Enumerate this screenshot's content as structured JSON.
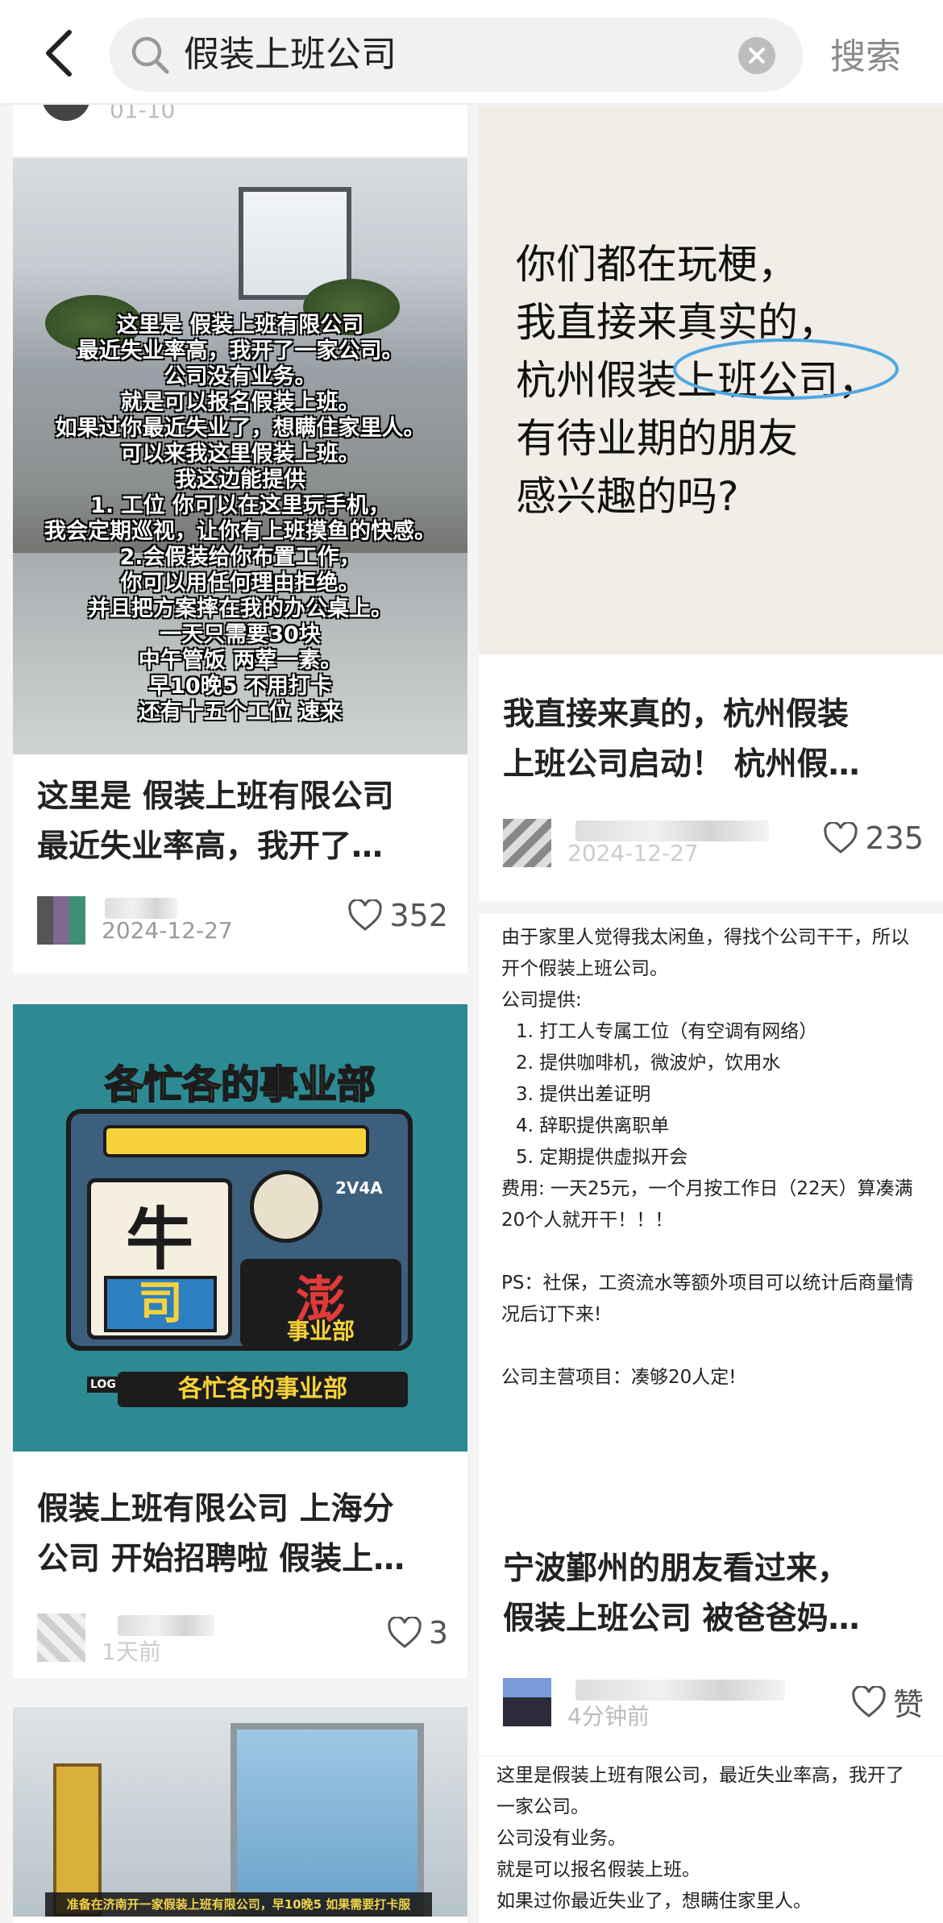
{
  "search": {
    "query": "假装上班公司",
    "button_label": "搜索"
  },
  "top_remnant": {
    "date": "01-10"
  },
  "left": [
    {
      "image_text": [
        "这里是  假装上班有限公司",
        "最近失业率高，我开了一家公司。",
        "公司没有业务。",
        "就是可以报名假装上班。",
        "如果过你最近失业了，想瞒住家里人。",
        "可以来我这里假装上班。",
        "我这边能提供",
        "1. 工位 你可以在这里玩手机，",
        "我会定期巡视，让你有上班摸鱼的快感。",
        "2.会假装给你布置工作，",
        "你可以用任何理由拒绝。",
        "并且把方案摔在我的办公桌上。",
        "一天只需要30块",
        "中午管饭 两荤一素。",
        "早10晚5 不用打卡",
        "还有十五个工位 速来"
      ],
      "title_line1": "这里是 假装上班有限公司",
      "title_line2": "最近失业率高，我开了…",
      "date": "2024-12-27",
      "likes": "352"
    },
    {
      "image_text_top": "各忙各的事业部",
      "image_big_left_1": "牛",
      "image_big_left_2": "司",
      "image_big_right": "澎",
      "image_sub_right": "事业部",
      "image_bottom": "各忙各的事业部",
      "image_badge": "2V4A",
      "image_small_tag": "LOG",
      "title_line1": "假装上班有限公司 上海分",
      "title_line2": "公司 开始招聘啦 假装上…",
      "date": "1天前",
      "likes": "3"
    },
    {
      "image_caption": "准备在济南开一家假装上班有限公司，早10晚5 如果需要打卡服"
    }
  ],
  "right": [
    {
      "image_lines": [
        "你们都在玩梗，",
        "我直接来真实的，",
        "杭州假装上班公司，",
        "有待业期的朋友",
        "感兴趣的吗?"
      ],
      "title_line1": "我直接来真的，杭州假装",
      "title_line2": "上班公司启动！ 杭州假…",
      "date": "2024-12-27",
      "likes": "235"
    },
    {
      "intro": "由于家里人觉得我太闲鱼，得找个公司干干，所以开个假装上班公司。",
      "provides": "公司提供:",
      "items": [
        "1.   打工人专属工位（有空调有网络）",
        "2.   提供咖啡机，微波炉，饮用水",
        "3.   提供出差证明",
        "4.   辞职提供离职单",
        "5.   定期提供虚拟开会"
      ],
      "fee": "费用:   一天25元，一个月按工作日（22天）算凑满20个人就开干！！！",
      "ps": "PS：社保，工资流水等额外项目可以统计后商量情况后订下来!",
      "main": "公司主营项目：凑够20人定!",
      "title_line1": "宁波鄞州的朋友看过来，",
      "title_line2": "假装上班公司 被爸爸妈…",
      "date": "4分钟前",
      "likes": "赞"
    },
    {
      "lines": [
        "这里是假装上班有限公司，最近失业率高，我开了",
        "一家公司。",
        "公司没有业务。",
        "就是可以报名假装上班。",
        "如果过你最近失业了，想瞒住家里人。"
      ]
    }
  ]
}
